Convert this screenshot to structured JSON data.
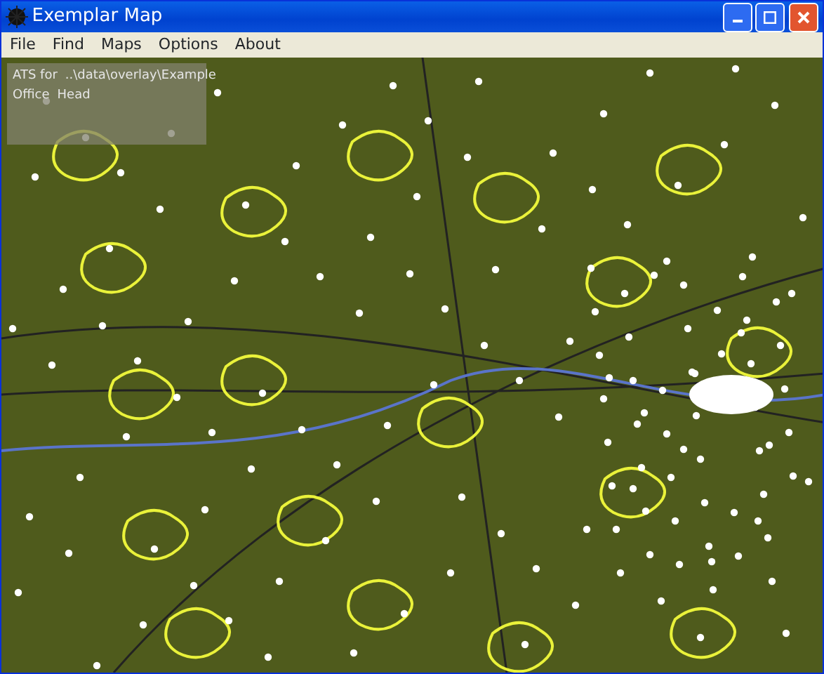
{
  "window": {
    "title": "Exemplar Map"
  },
  "menu": [
    "File",
    "Find",
    "Maps",
    "Options",
    "About"
  ],
  "overlay": {
    "rows": [
      {
        "label": "ATS for",
        "value": "..\\data\\overlay\\Example"
      },
      {
        "label": "Office",
        "value": "Head"
      }
    ]
  }
}
